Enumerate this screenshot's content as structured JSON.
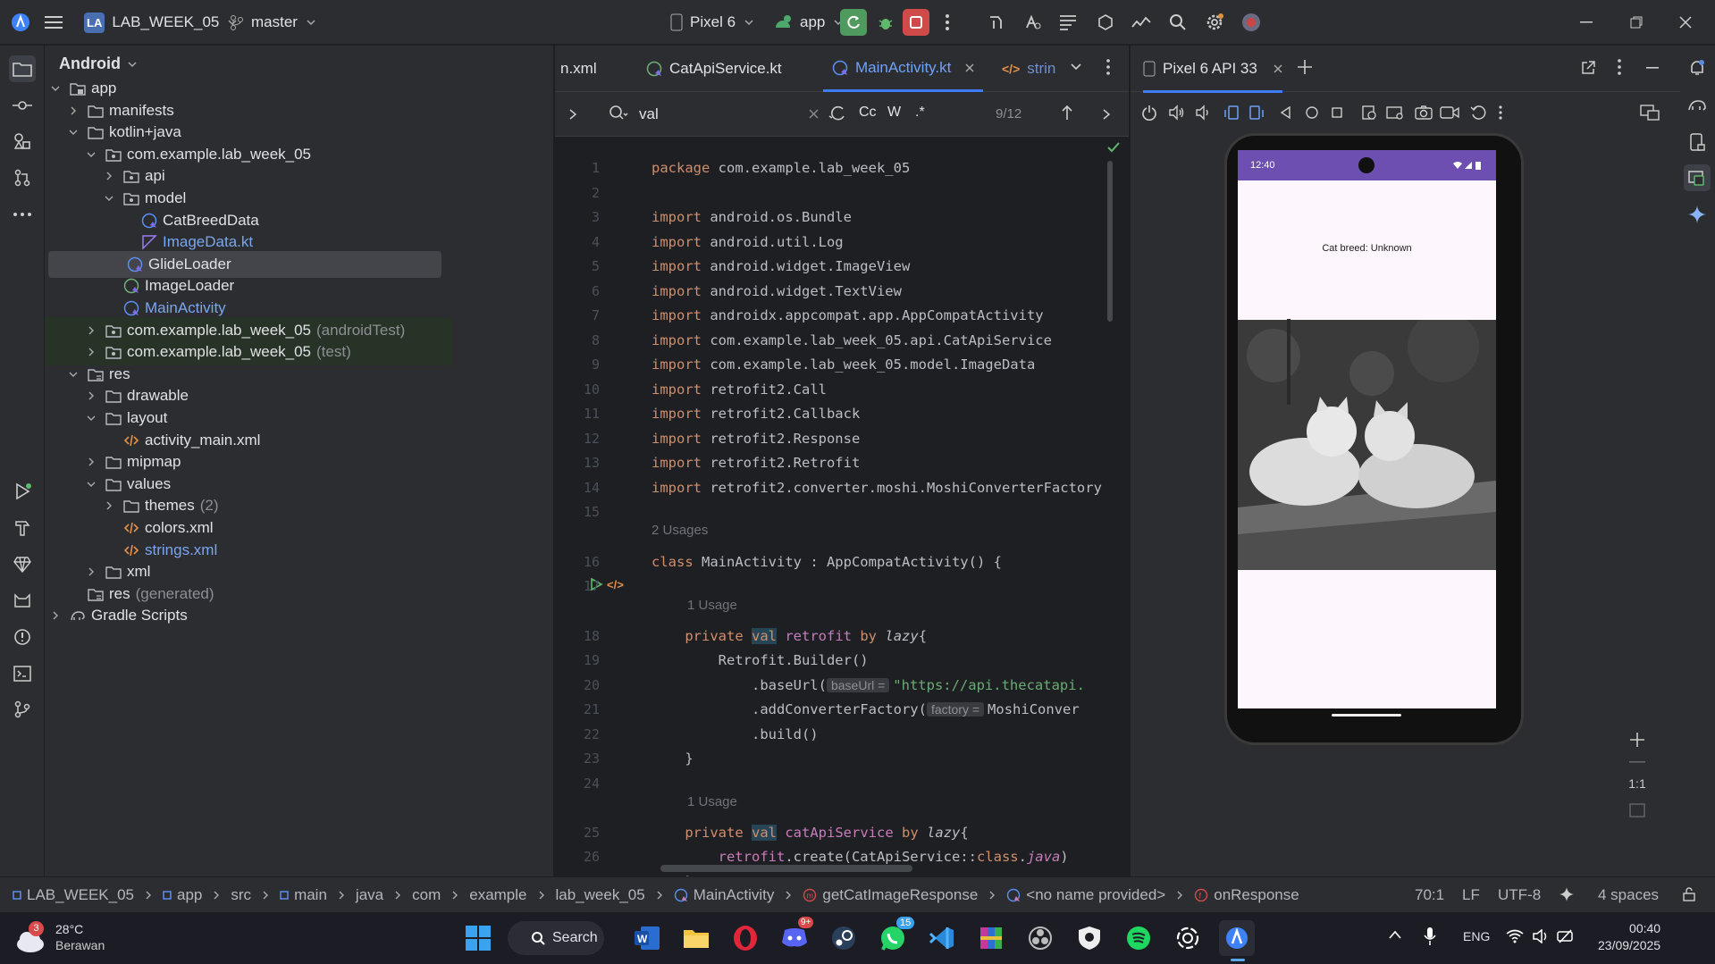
{
  "titlebar": {
    "app_logo": "android-studio-icon",
    "project_badge": "LA",
    "project_name": "LAB_WEEK_05",
    "branch": "master",
    "device": "Pixel 6",
    "run_config": "app"
  },
  "project": {
    "view": "Android",
    "tree": [
      {
        "label": "app",
        "depth": 0,
        "expanded": true,
        "icon": "module"
      },
      {
        "label": "manifests",
        "depth": 1,
        "expanded": false,
        "icon": "folder"
      },
      {
        "label": "kotlin+java",
        "depth": 1,
        "expanded": true,
        "icon": "folder"
      },
      {
        "label": "com.example.lab_week_05",
        "depth": 2,
        "expanded": true,
        "icon": "package"
      },
      {
        "label": "api",
        "depth": 3,
        "expanded": false,
        "icon": "package"
      },
      {
        "label": "model",
        "depth": 3,
        "expanded": true,
        "icon": "package"
      },
      {
        "label": "CatBreedData",
        "depth": 4,
        "icon": "kotlin-class"
      },
      {
        "label": "ImageData.kt",
        "depth": 4,
        "icon": "kotlin-file",
        "color": "blue"
      },
      {
        "label": "GlideLoader",
        "depth": 3,
        "icon": "kotlin-class",
        "selected": true
      },
      {
        "label": "ImageLoader",
        "depth": 3,
        "icon": "kotlin-interface"
      },
      {
        "label": "MainActivity",
        "depth": 3,
        "icon": "kotlin-class",
        "color": "blue"
      },
      {
        "label": "com.example.lab_week_05",
        "suffix": "(androidTest)",
        "depth": 2,
        "expanded": false,
        "icon": "package",
        "tint": true
      },
      {
        "label": "com.example.lab_week_05",
        "suffix": "(test)",
        "depth": 2,
        "expanded": false,
        "icon": "package",
        "tint": true
      },
      {
        "label": "res",
        "depth": 1,
        "expanded": true,
        "icon": "res-folder"
      },
      {
        "label": "drawable",
        "depth": 2,
        "expanded": false,
        "icon": "folder"
      },
      {
        "label": "layout",
        "depth": 2,
        "expanded": true,
        "icon": "folder"
      },
      {
        "label": "activity_main.xml",
        "depth": 3,
        "icon": "xml"
      },
      {
        "label": "mipmap",
        "depth": 2,
        "expanded": false,
        "icon": "folder"
      },
      {
        "label": "values",
        "depth": 2,
        "expanded": true,
        "icon": "folder"
      },
      {
        "label": "themes",
        "suffix": "(2)",
        "depth": 3,
        "expanded": false,
        "icon": "folder"
      },
      {
        "label": "colors.xml",
        "depth": 3,
        "icon": "xml"
      },
      {
        "label": "strings.xml",
        "depth": 3,
        "icon": "xml",
        "color": "blue"
      },
      {
        "label": "xml",
        "depth": 2,
        "expanded": false,
        "icon": "folder"
      },
      {
        "label": "res",
        "suffix": "(generated)",
        "depth": 1,
        "icon": "res-folder"
      },
      {
        "label": "Gradle Scripts",
        "depth": 0,
        "expanded": false,
        "icon": "gradle"
      }
    ]
  },
  "editor": {
    "tabs": [
      {
        "label": "n.xml",
        "icon": "xml"
      },
      {
        "label": "CatApiService.kt",
        "icon": "kotlin-interface"
      },
      {
        "label": "MainActivity.kt",
        "icon": "kotlin-class",
        "active": true
      },
      {
        "label": "strin",
        "icon": "xml"
      }
    ],
    "find": {
      "query": "val",
      "match_case": "Cc",
      "words": "W",
      "regex": ".*",
      "count": "9/12"
    },
    "usages": {
      "class": "2 Usages",
      "retrofit": "1 Usage",
      "service": "1 Usage"
    },
    "hints": {
      "baseUrl": "baseUrl =",
      "factory": "factory ="
    }
  },
  "device": {
    "tab": "Pixel 6 API 33",
    "status_time": "12:40",
    "text": "Cat breed: Unknown",
    "zoom_label": "1:1"
  },
  "statusbar": {
    "crumbs": [
      "LAB_WEEK_05",
      "app",
      "src",
      "main",
      "java",
      "com",
      "example",
      "lab_week_05",
      "MainActivity",
      "getCatImageResponse",
      "<no name provided>",
      "onResponse"
    ],
    "position": "70:1",
    "line_sep": "LF",
    "encoding": "UTF-8",
    "indent": "4 spaces"
  },
  "taskbar": {
    "weather_temp": "28°C",
    "weather_desc": "Berawan",
    "weather_badge": "3",
    "search": "Search",
    "discord_badge": "9+",
    "whatsapp_badge": "15",
    "lang": "ENG",
    "time": "00:40",
    "date": "23/09/2025"
  }
}
